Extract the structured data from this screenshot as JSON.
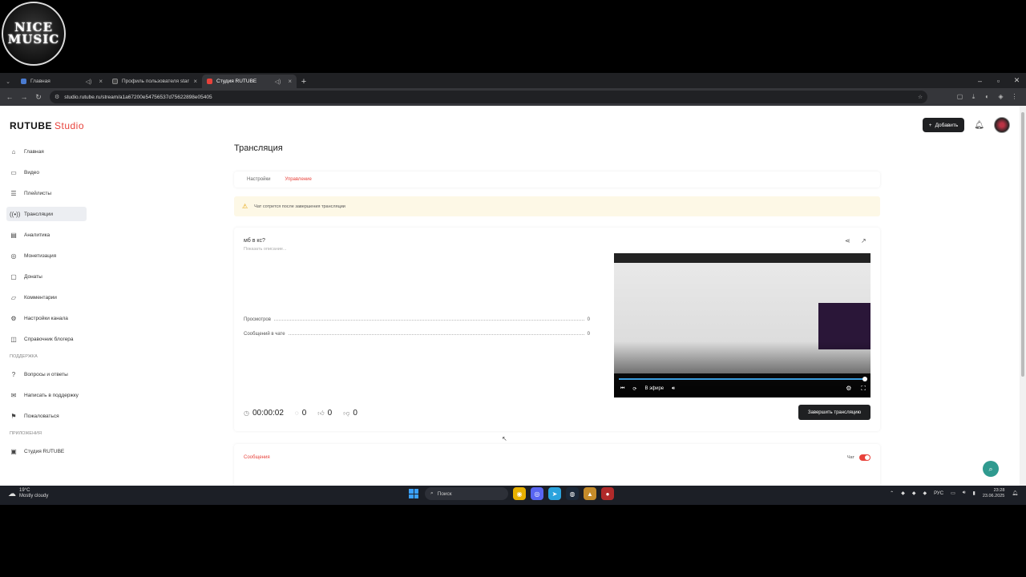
{
  "overlay": {
    "logo_text_1": "NICE",
    "logo_text_2": "MUSIC"
  },
  "browser": {
    "tabs": [
      {
        "title": "Главная",
        "active": false
      },
      {
        "title": "Профиль пользователя stam...",
        "active": false
      },
      {
        "title": "Студия RUTUBE",
        "active": true
      }
    ],
    "url": "studio.rutube.ru/stream/a1a67200e54756537d75622898e05405"
  },
  "header": {
    "brand": "RUTUBE",
    "brand_suffix": "Studio",
    "add_label": "Добавить"
  },
  "sidebar": {
    "items": [
      {
        "label": "Главная",
        "icon": "home-icon"
      },
      {
        "label": "Видео",
        "icon": "video-icon"
      },
      {
        "label": "Плейлисты",
        "icon": "playlist-icon"
      },
      {
        "label": "Трансляции",
        "icon": "broadcast-icon"
      },
      {
        "label": "Аналитика",
        "icon": "analytics-icon"
      },
      {
        "label": "Монетизация",
        "icon": "monetization-icon"
      },
      {
        "label": "Донаты",
        "icon": "donate-icon"
      },
      {
        "label": "Комментарии",
        "icon": "comments-icon"
      },
      {
        "label": "Настройки канала",
        "icon": "gear-icon"
      },
      {
        "label": "Справочник блогера",
        "icon": "book-icon"
      }
    ],
    "support_heading": "ПОДДЕРЖКА",
    "support": [
      {
        "label": "Вопросы и ответы"
      },
      {
        "label": "Написать в поддержку"
      },
      {
        "label": "Пожаловаться"
      }
    ],
    "apps_heading": "ПРИЛОЖЕНИЯ",
    "apps": [
      {
        "label": "Студия RUTUBE"
      }
    ]
  },
  "main": {
    "title": "Трансляция",
    "tabs": [
      {
        "label": "Настройки"
      },
      {
        "label": "Управление"
      }
    ],
    "warning": "Чат сотрется после завершения трансляции",
    "stream": {
      "name": "мб в кс?",
      "desc_placeholder": "Показать описание...",
      "stats": [
        {
          "label": "Просмотров",
          "value": "0"
        },
        {
          "label": "Сообщений в чате",
          "value": "0"
        }
      ],
      "duration": "00:00:02",
      "viewers": "0",
      "likes": "0",
      "dislikes": "0",
      "live_label": "В эфире",
      "end_button": "Завершить трансляцию"
    },
    "messages_tab": "Сообщения",
    "chat_label": "Чат"
  },
  "taskbar": {
    "weather_temp": "19°C",
    "weather_desc": "Mostly cloudy",
    "search_label": "Поиск",
    "lang": "РУС",
    "time": "23:28",
    "date": "23.06.2025"
  }
}
